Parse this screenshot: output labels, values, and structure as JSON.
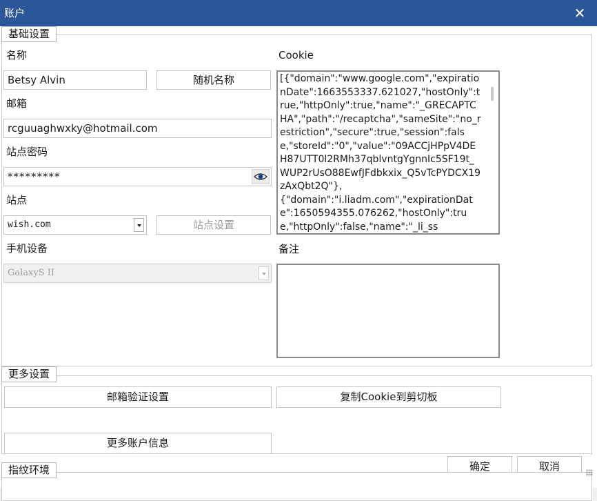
{
  "window": {
    "title": "账户",
    "close_label": "✕"
  },
  "basic": {
    "group_title": "基础设置",
    "name_label": "名称",
    "name_value": "Betsy Alvin",
    "random_name_button": "随机名称",
    "email_label": "邮箱",
    "email_value": "rcguuaghwxky@hotmail.com",
    "password_label": "站点密码",
    "password_value": "*********",
    "site_label": "站点",
    "site_value": "wish.com",
    "site_settings_button": "站点设置",
    "device_label": "手机设备",
    "device_value": "GalaxyS II",
    "cookie_label": "Cookie",
    "cookie_value": "[{\"domain\":\"www.google.com\",\"expirationDate\":1663553337.621027,\"hostOnly\":true,\"httpOnly\":true,\"name\":\"_GRECAPTCHA\",\"path\":\"/recaptcha\",\"sameSite\":\"no_restriction\",\"secure\":true,\"session\":false,\"storeId\":\"0\",\"value\":\"09ACCjHPpV4DEH87UTT0l2RMh37qblvntgYgnnIc5SF19t_WUP2rUsO88EwfJFdbkxix_Q5vTcPYDCX19zAxQbt2Q\"},\n{\"domain\":\"i.liadm.com\",\"expirationDate\":1650594355.076262,\"hostOnly\":true,\"httpOnly\":false,\"name\":\"_li_ss",
    "notes_label": "备注",
    "notes_value": ""
  },
  "more": {
    "group_title": "更多设置",
    "email_verify_button": "邮箱验证设置",
    "copy_cookie_button": "复制Cookie到剪切板",
    "more_info_button": "更多账户信息"
  },
  "fingerprint": {
    "group_title": "指纹环境"
  },
  "footer": {
    "ok_button": "确定",
    "cancel_button": "取消"
  },
  "colors": {
    "titlebar": "#2b579a",
    "border": "#c4c4c4"
  }
}
